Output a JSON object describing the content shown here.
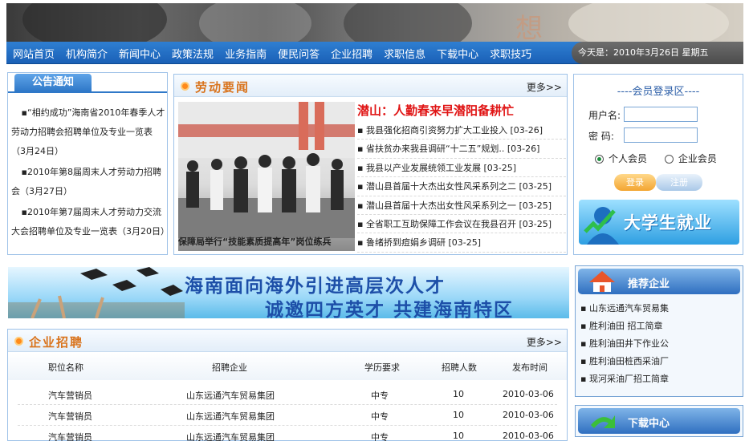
{
  "header": {
    "banner_glyph": "想",
    "nav_items": [
      "网站首页",
      "机构简介",
      "新闻中心",
      "政策法规",
      "业务指南",
      "便民问答",
      "企业招聘",
      "求职信息",
      "下载中心",
      "求职技巧"
    ],
    "date_text": "今天是：2010年3月26日  星期五"
  },
  "notice": {
    "title": "公告通知",
    "items": [
      "“相约成功”海南省2010年春季人才劳动力招聘会招聘单位及专业一览表（3月24日）",
      "2010年第8届周末人才劳动力招聘会（3月27日）",
      "2010年第7届周末人才劳动力交流大会招聘单位及专业一览表（3月20日）"
    ]
  },
  "labor_news": {
    "title": "劳动要闻",
    "more": "更多>>",
    "photo_caption": "保障局举行“技能素质提高年”岗位练兵",
    "headline": "潜山：人勤春来早潜阳备耕忙",
    "items": [
      "我县强化招商引资努力扩大工业投入 [03-26]",
      "省扶贫办来我县调研“十二五”规划.. [03-26]",
      "我县以产业发展统领工业发展 [03-25]",
      "潜山县首届十大杰出女性风采系列之二 [03-25]",
      "潜山县首届十大杰出女性风采系列之一 [03-25]",
      "全省职工互助保障工作会议在我县召开 [03-25]",
      "鲁绪挢到痘娟乡调研 [03-25]"
    ]
  },
  "login": {
    "title": "----会员登录区----",
    "username_label": "用户名:",
    "password_label": "密  码:",
    "username_value": "",
    "password_value": "",
    "radio_personal": "个人会员",
    "radio_company": "企业会员",
    "login_button": "登录",
    "register_button": "注册",
    "grad_banner": "大学生就业"
  },
  "talent_banner": {
    "line1": "海南面向海外引进高层次人才",
    "line2": "诚邀四方英才  共建海南特区"
  },
  "recommend": {
    "title": "推荐企业",
    "items": [
      "山东远通汽车贸易集",
      "胜利油田 招工简章",
      "胜利油田井下作业公",
      "胜利油田桩西采油厂",
      "现河采油厂招工简章"
    ]
  },
  "download": {
    "title": "下载中心"
  },
  "jobs": {
    "title": "企业招聘",
    "more": "更多>>",
    "columns": [
      "职位名称",
      "招聘企业",
      "学历要求",
      "招聘人数",
      "发布时间"
    ],
    "rows": [
      [
        "汽车营销员",
        "山东远通汽车贸易集团",
        "中专",
        "10",
        "2010-03-06"
      ],
      [
        "汽车营销员",
        "山东远通汽车贸易集团",
        "中专",
        "10",
        "2010-03-06"
      ],
      [
        "汽车营销员",
        "山东远通汽车贸易集团",
        "中专",
        "10",
        "2010-03-06"
      ]
    ]
  },
  "colors": {
    "nav_blue": "#1a60b6",
    "accent_orange": "#d9731c",
    "headline_red": "#e01414",
    "panel_border": "#9fc2e8"
  }
}
